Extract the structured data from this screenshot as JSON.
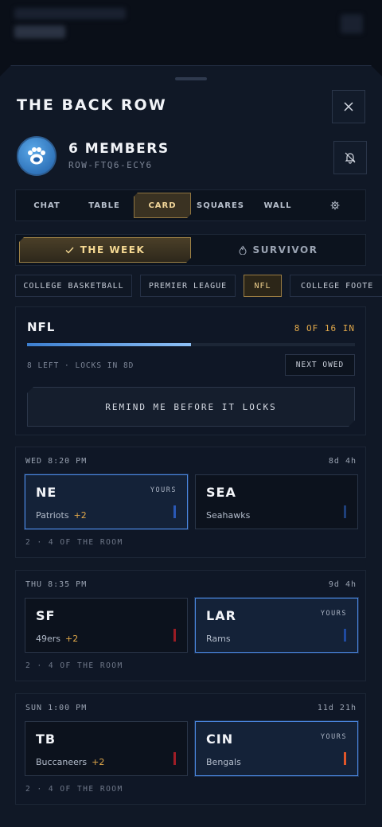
{
  "group": {
    "title": "THE BACK ROW",
    "members_label": "6 MEMBERS",
    "code": "ROW-FTQ6-ECY6"
  },
  "tabs": [
    {
      "label": "CHAT",
      "active": false
    },
    {
      "label": "TABLE",
      "active": false
    },
    {
      "label": "CARD",
      "active": true
    },
    {
      "label": "SQUARES",
      "active": false
    },
    {
      "label": "WALL",
      "active": false
    }
  ],
  "segment": {
    "week_label": "THE WEEK",
    "survivor_label": "SURVIVOR",
    "selected": "week"
  },
  "leagues": [
    {
      "label": "COLLEGE BASKETBALL",
      "active": false
    },
    {
      "label": "PREMIER LEAGUE",
      "active": false
    },
    {
      "label": "NFL",
      "active": true
    },
    {
      "label": "COLLEGE FOOTE",
      "active": false
    }
  ],
  "summary": {
    "league": "NFL",
    "count": "8 OF 16 IN",
    "progress_fraction": 0.5,
    "meta": "8 LEFT · LOCKS IN 8D",
    "next_owed": "NEXT OWED",
    "remind": "REMIND ME BEFORE IT LOCKS"
  },
  "games": [
    {
      "time": "WED 8:20 PM",
      "countdown": "8d 4h",
      "room": "2 · 4 OF THE ROOM",
      "away": {
        "abbr": "NE",
        "name": "Patriots",
        "spread": "+2",
        "yours": "YOURS",
        "picked": true,
        "color": "#1e3a78"
      },
      "home": {
        "abbr": "SEA",
        "name": "Seahawks",
        "spread": "",
        "yours": "",
        "picked": false,
        "color": "#1e3f7a"
      }
    },
    {
      "time": "THU 8:35 PM",
      "countdown": "9d 4h",
      "room": "2 · 4 OF THE ROOM",
      "away": {
        "abbr": "SF",
        "name": "49ers",
        "spread": "+2",
        "yours": "",
        "picked": false,
        "color": "#9a1c24"
      },
      "home": {
        "abbr": "LAR",
        "name": "Rams",
        "spread": "",
        "yours": "YOURS",
        "picked": true,
        "color": "#1f4aa0"
      }
    },
    {
      "time": "SUN 1:00 PM",
      "countdown": "11d 21h",
      "room": "2 · 4 OF THE ROOM",
      "away": {
        "abbr": "TB",
        "name": "Buccaneers",
        "spread": "+2",
        "yours": "",
        "picked": false,
        "color": "#a01d26"
      },
      "home": {
        "abbr": "CIN",
        "name": "Bengals",
        "spread": "",
        "yours": "YOURS",
        "picked": true,
        "color": "#e0562a"
      }
    }
  ],
  "colors": {
    "accent_gold": "#f2d38f",
    "accent_blue": "#4a86df",
    "spread": "#e2a94a"
  }
}
